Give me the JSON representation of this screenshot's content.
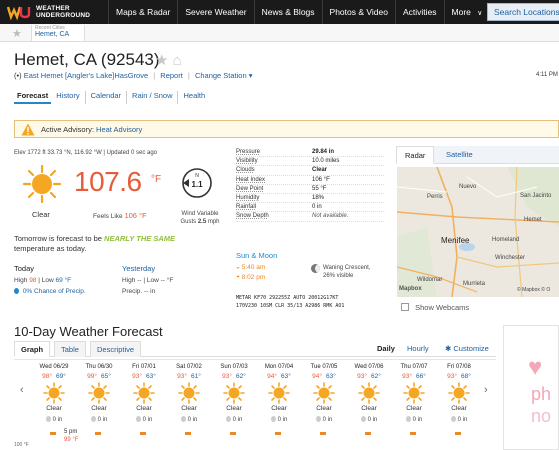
{
  "brand": {
    "line1": "WEATHER",
    "line2": "UNDERGROUND"
  },
  "nav": {
    "items": [
      "Maps & Radar",
      "Severe Weather",
      "News & Blogs",
      "Photos & Video",
      "Activities",
      "More"
    ],
    "more_caret": "∨",
    "search_placeholder": "Search Locations"
  },
  "recent": {
    "label": "Recent Cities",
    "city": "Hemet, CA"
  },
  "header": {
    "city_title": "Hemet, CA (92543)",
    "local_time": "4:11 PM",
    "station_prefix": "(•)",
    "station_name": "East Hemet [Angler's Lake]",
    "has_grove": "HasGrove",
    "report": "Report",
    "change_station": "Change Station",
    "change_caret": "▾"
  },
  "subnav": [
    "Forecast",
    "History",
    "Calendar",
    "Rain / Snow",
    "Health"
  ],
  "advisory": {
    "label": "Active Advisory:",
    "link": "Heat Advisory"
  },
  "current": {
    "elev_line": "Elev 1772 ft 33.73 °N, 116.92 °W  |  Updated 0 sec ago",
    "condition": "Clear",
    "temp": "107.6",
    "unit": "°F",
    "feels_prefix": "Feels Like",
    "feels_value": "106 °F",
    "wind_dir": "N",
    "wind_speed": "1.1",
    "wind_line1": "Wind Variable",
    "wind_line2_prefix": "Gusts",
    "wind_gust": "2.5",
    "wind_unit": "mph",
    "forecast_prefix": "Tomorrow is forecast to be",
    "forecast_same": "NEARLY THE SAME",
    "forecast_suffix": "temperature as today."
  },
  "today": {
    "label": "Today",
    "high_label": "High",
    "high": "98",
    "low_label": "Low",
    "low": "69 °F",
    "sep": "|",
    "precip": "0% Chance of Precip."
  },
  "yesterday": {
    "label": "Yesterday",
    "high_label": "High",
    "high": "--",
    "low_label": "Low",
    "low": "-- °F",
    "sep": "|",
    "precip": "Precip. -- in"
  },
  "details": [
    {
      "label": "Pressure",
      "value": "29.84 in",
      "bold": true
    },
    {
      "label": "Visibility",
      "value": "10.0 miles"
    },
    {
      "label": "Clouds",
      "value": "Clear",
      "bold": true
    },
    {
      "label": "Heat Index",
      "value": "106 °F"
    },
    {
      "label": "Dew Point",
      "value": "55 °F"
    },
    {
      "label": "Humidity",
      "value": "18%"
    },
    {
      "label": "Rainfall",
      "value": "0 in"
    },
    {
      "label": "Snow Depth",
      "value": "Not available.",
      "italic": true
    }
  ],
  "sunmoon": {
    "title": "Sun & Moon",
    "sunrise": "5:40 am",
    "sunset": "8:02 pm",
    "moon_phase": "Waning Crescent,",
    "moon_visible": "26% visible"
  },
  "metar": {
    "line1": "METAR KF70 292255Z AUTO 20012G17KT",
    "line2": "170V230 10SM CLR 35/13 A2986 RMK AO1"
  },
  "map": {
    "tabs": [
      "Radar",
      "Satellite"
    ],
    "labels": [
      "Perris",
      "Nuevo",
      "San Jacinto",
      "Hemet",
      "Menifee",
      "Wildomar",
      "Winchester",
      "Homeland",
      "Murrieta",
      "Mapbox"
    ],
    "copyright": "© Mapbox © O",
    "webcams": "Show Webcams"
  },
  "tenday": {
    "title": "10-Day Weather Forecast",
    "tabs": [
      "Graph",
      "Table",
      "Descriptive"
    ],
    "daily": "Daily",
    "hourly": "Hourly",
    "customize": "Customize",
    "left_arrow": "‹",
    "right_arrow": "›",
    "days": [
      {
        "name": "Wed 06/29",
        "hi": "98°",
        "lo": "69°",
        "cond": "Clear",
        "precip": "0 in"
      },
      {
        "name": "Thu 06/30",
        "hi": "99°",
        "lo": "65°",
        "cond": "Clear",
        "precip": "0 in"
      },
      {
        "name": "Fri 07/01",
        "hi": "93°",
        "lo": "63°",
        "cond": "Clear",
        "precip": "0 in"
      },
      {
        "name": "Sat 07/02",
        "hi": "93°",
        "lo": "61°",
        "cond": "Clear",
        "precip": "0 in"
      },
      {
        "name": "Sun 07/03",
        "hi": "93°",
        "lo": "62°",
        "cond": "Clear",
        "precip": "0 in"
      },
      {
        "name": "Mon 07/04",
        "hi": "94°",
        "lo": "63°",
        "cond": "Clear",
        "precip": "0 in"
      },
      {
        "name": "Tue 07/05",
        "hi": "94°",
        "lo": "63°",
        "cond": "Clear",
        "precip": "0 in"
      },
      {
        "name": "Wed 07/06",
        "hi": "93°",
        "lo": "62°",
        "cond": "Clear",
        "precip": "0 in"
      },
      {
        "name": "Thu 07/07",
        "hi": "93°",
        "lo": "66°",
        "cond": "Clear",
        "precip": "0 in"
      },
      {
        "name": "Fri 07/08",
        "hi": "93°",
        "lo": "68°",
        "cond": "Clear",
        "precip": "0 in"
      }
    ],
    "tip_time": "5 pm",
    "tip_temp": "99 °F",
    "axis_label": "100 °F"
  },
  "ad": {
    "line1": "ph",
    "line2": "no"
  },
  "colors": {
    "accent": "#1e8acc",
    "hot": "#e85b3a",
    "cold": "#1e5f9e",
    "nav_bg": "#1a1a1a"
  }
}
